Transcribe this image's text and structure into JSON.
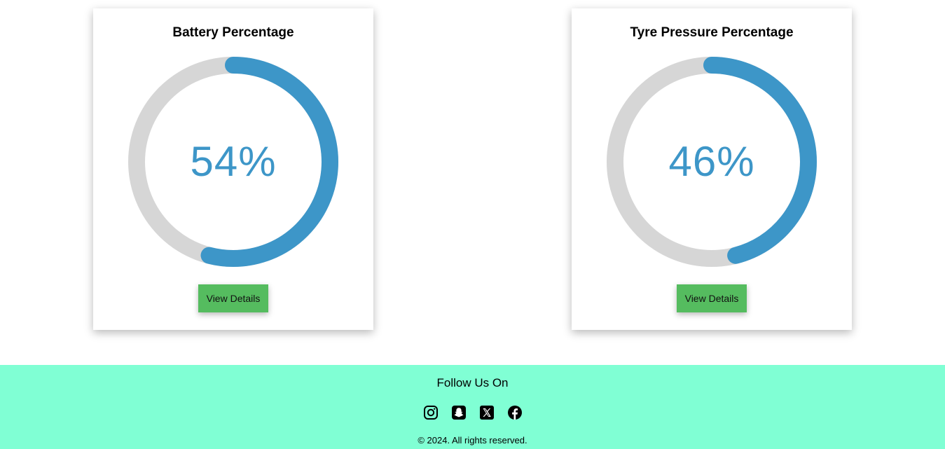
{
  "cards": [
    {
      "title": "Battery Percentage",
      "value": 54,
      "value_label": "54%",
      "button_label": "View Details"
    },
    {
      "title": "Tyre Pressure Percentage",
      "value": 46,
      "value_label": "46%",
      "button_label": "View Details"
    }
  ],
  "colors": {
    "gauge_fill": "#3d96c8",
    "gauge_track": "#d6d6d6",
    "button": "#55bc5f",
    "footer_bg": "#80ffd4"
  },
  "footer": {
    "follow_label": "Follow Us On",
    "social_icons": [
      "instagram-icon",
      "snapchat-icon",
      "x-icon",
      "facebook-icon"
    ],
    "copyright": "© 2024. All rights reserved."
  }
}
